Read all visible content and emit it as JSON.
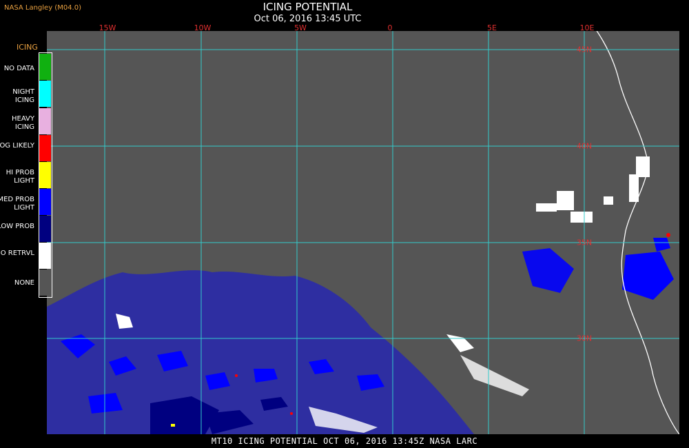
{
  "header": {
    "credit": "NASA Langley (M04.0)",
    "title": "ICING POTENTIAL",
    "subtitle": "Oct 06, 2016 13:45 UTC"
  },
  "longitude_labels": [
    "15W",
    "10W",
    "5W",
    "0",
    "5E",
    "10E"
  ],
  "latitude_labels": [
    "45N",
    "40N",
    "35N",
    "30N"
  ],
  "legend": {
    "title": "ICING",
    "items": [
      {
        "label": "NO DATA",
        "color": "#10b010"
      },
      {
        "label": "NIGHT ICING",
        "color": "#00ffff"
      },
      {
        "label": "HEAVY ICING",
        "color": "#e8b0e0"
      },
      {
        "label": "MOG LIKELY",
        "color": "#ff0000"
      },
      {
        "label": "HI PROB LIGHT",
        "color": "#ffff00"
      },
      {
        "label": "MED PROB LIGHT",
        "color": "#0000ff"
      },
      {
        "label": "LOW PROB",
        "color": "#000080"
      },
      {
        "label": "NO RETRVL",
        "color": "#ffffff"
      },
      {
        "label": "NONE",
        "color": "#555555"
      }
    ]
  },
  "footer": "MT10  ICING POTENTIAL  OCT 06, 2016 13:45Z  NASA LARC",
  "colors": {
    "grid": "#33cccc",
    "background": "#555555",
    "coastline": "#ffffff"
  }
}
